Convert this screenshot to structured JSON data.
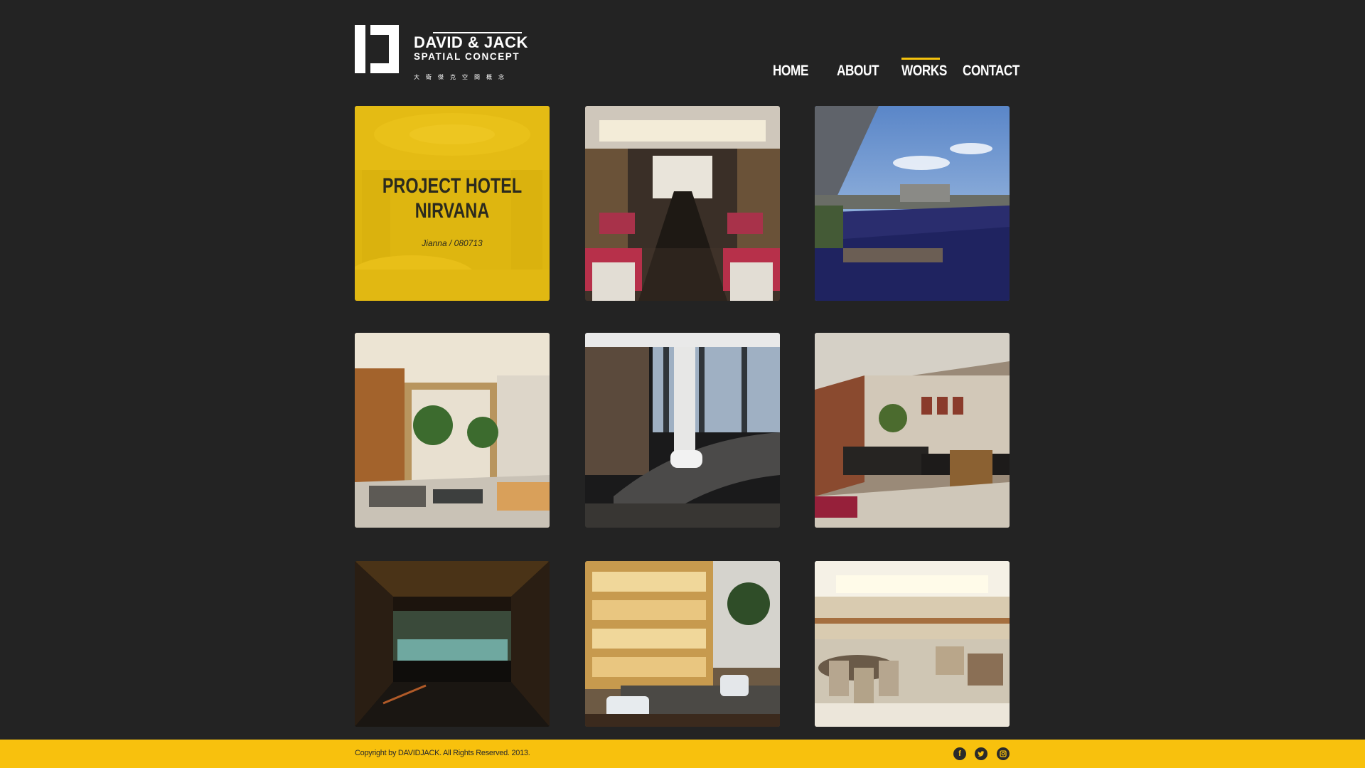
{
  "brand": {
    "name": "DAVID & JACK",
    "tagline": "SPATIAL CONCEPT",
    "chinese_name": "大衛傑克空間概念"
  },
  "nav": {
    "items": [
      {
        "label": "HOME",
        "active": false
      },
      {
        "label": "ABOUT",
        "active": false
      },
      {
        "label": "WORKS",
        "active": true
      },
      {
        "label": "CONTACT",
        "active": false
      }
    ]
  },
  "featured": {
    "title_line1": "PROJECT HOTEL",
    "title_line2": "NIRVANA",
    "subtitle": "Jianna / 080713"
  },
  "gallery": {
    "tiles": [
      {
        "subject": "hotel-lobby-featured"
      },
      {
        "subject": "conference-room"
      },
      {
        "subject": "rooftop-pool"
      },
      {
        "subject": "lobby-with-plants"
      },
      {
        "subject": "lounge-with-view"
      },
      {
        "subject": "brick-wall-lounge"
      },
      {
        "subject": "dark-corridor"
      },
      {
        "subject": "library-lounge"
      },
      {
        "subject": "dining-room"
      }
    ]
  },
  "footer": {
    "copyright": "Copyright by DAVIDJACK. All Rights Reserved. 2013.",
    "social": [
      {
        "icon": "facebook-icon",
        "glyph": "f"
      },
      {
        "icon": "twitter-icon"
      },
      {
        "icon": "instagram-icon"
      }
    ]
  },
  "colors": {
    "background": "#232323",
    "accent": "#f8c10d",
    "text_light": "#ffffff",
    "text_dark": "#2a2a2a"
  }
}
